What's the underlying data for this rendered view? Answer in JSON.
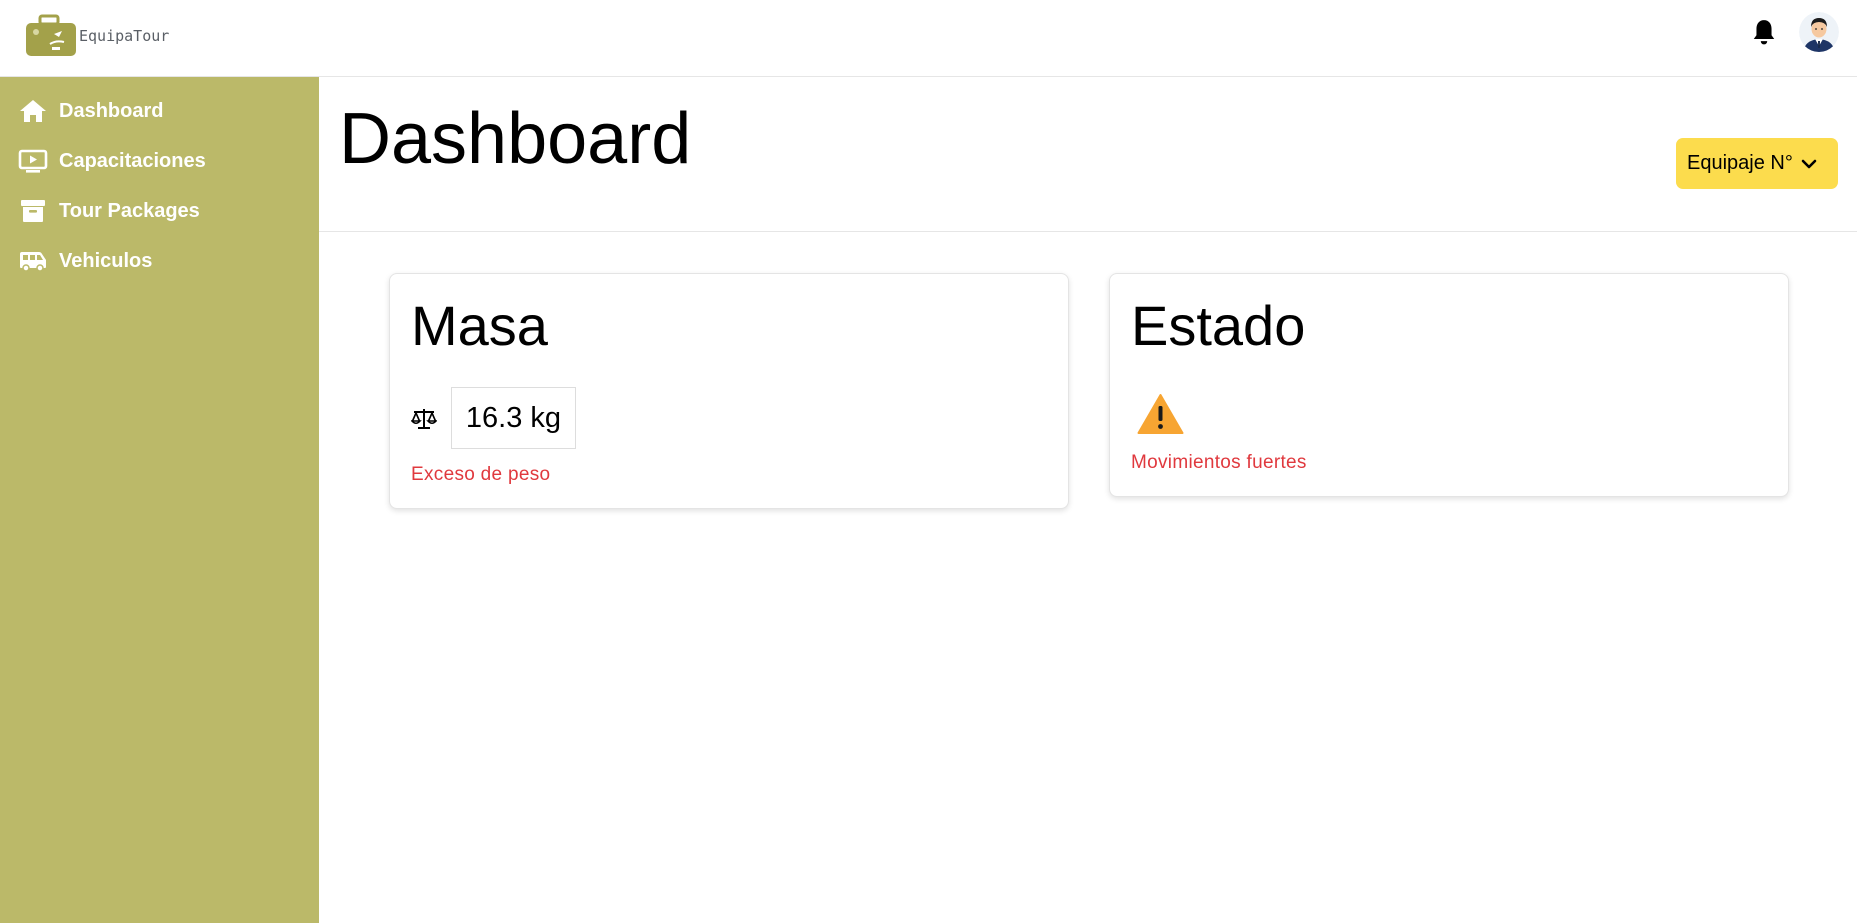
{
  "app": {
    "brand_name": "EquipaTour"
  },
  "topbar": {
    "notifications_icon": "bell-icon",
    "avatar_icon": "user-avatar"
  },
  "sidebar": {
    "items": [
      {
        "label": "Dashboard",
        "icon": "home-icon"
      },
      {
        "label": "Capacitaciones",
        "icon": "video-icon"
      },
      {
        "label": "Tour Packages",
        "icon": "archive-icon"
      },
      {
        "label": "Vehiculos",
        "icon": "bus-icon"
      }
    ]
  },
  "header": {
    "title": "Dashboard",
    "luggage_select_label": "Equipaje N°"
  },
  "cards": {
    "mass": {
      "title": "Masa",
      "icon": "scale-icon",
      "value": "16.3 kg",
      "alert": "Exceso de peso"
    },
    "state": {
      "title": "Estado",
      "icon": "warning-icon",
      "alert": "Movimientos fuertes"
    }
  },
  "colors": {
    "sidebar_bg": "#bbb969",
    "button_bg": "#fcdc4d",
    "alert_text": "#e0393e",
    "warning_icon": "#f7a532",
    "logo": "#a3a14a"
  }
}
